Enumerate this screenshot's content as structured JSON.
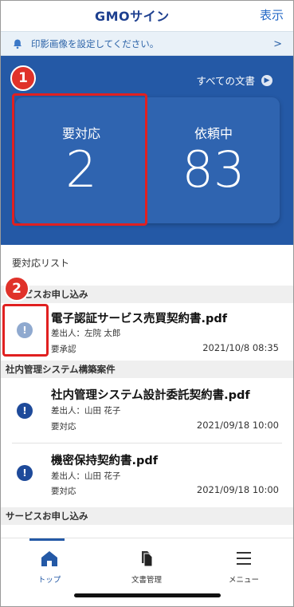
{
  "header": {
    "logo": "GMOサイン",
    "display_label": "表示"
  },
  "notice": {
    "text": "印影画像を設定してください。",
    "chevron": ">"
  },
  "dashboard": {
    "all_docs_label": "すべての文書",
    "cards": [
      {
        "label": "要対応",
        "value": "2"
      },
      {
        "label": "依頼中",
        "value": "83"
      }
    ]
  },
  "annotations": {
    "badge1": "1",
    "badge2": "2"
  },
  "list": {
    "title": "要対応リスト",
    "sections": [
      {
        "name": "サービスお申し込み",
        "items": [
          {
            "title": "電子認証サービス売買契約書.pdf",
            "sender": "差出人：左院 太郎",
            "status": "要承認",
            "date": "2021/10/8 08:35",
            "icon": "info-icon"
          }
        ]
      },
      {
        "name": "社内管理システム構築案件",
        "items": [
          {
            "title": "社内管理システム設計委託契約書.pdf",
            "sender": "差出人：山田 花子",
            "status": "要対応",
            "date": "2021/09/18 10:00",
            "icon": "alert-icon"
          },
          {
            "title": "機密保持契約書.pdf",
            "sender": "差出人：山田 花子",
            "status": "要対応",
            "date": "2021/09/18 10:00",
            "icon": "alert-icon"
          }
        ]
      },
      {
        "name": "サービスお申し込み",
        "items": []
      }
    ]
  },
  "bottom_nav": {
    "items": [
      {
        "label": "トップ",
        "icon": "home-icon"
      },
      {
        "label": "文書管理",
        "icon": "documents-icon"
      },
      {
        "label": "メニュー",
        "icon": "menu-icon"
      }
    ]
  },
  "colors": {
    "brand_blue": "#2459a6",
    "highlight_red": "#e02020",
    "pending_icon": "#1e4a9a",
    "approve_icon": "#8fa9cf"
  }
}
